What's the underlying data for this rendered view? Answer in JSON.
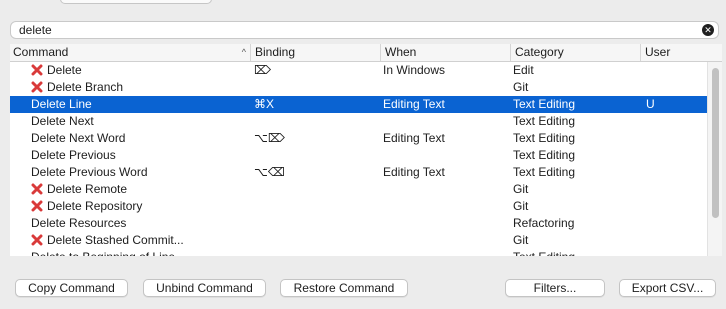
{
  "search": {
    "value": "delete"
  },
  "table": {
    "columns": [
      "Command",
      "Binding",
      "When",
      "Category",
      "User"
    ],
    "rows": [
      {
        "command": "Delete",
        "binding": "⌦",
        "when": "In Windows",
        "category": "Edit",
        "user": "",
        "icon": true,
        "selected": false
      },
      {
        "command": "Delete Branch",
        "binding": "",
        "when": "",
        "category": "Git",
        "user": "",
        "icon": true,
        "selected": false
      },
      {
        "command": "Delete Line",
        "binding": "⌘X",
        "when": "Editing Text",
        "category": "Text Editing",
        "user": "U",
        "icon": false,
        "selected": true
      },
      {
        "command": "Delete Next",
        "binding": "",
        "when": "",
        "category": "Text Editing",
        "user": "",
        "icon": false,
        "selected": false
      },
      {
        "command": "Delete Next Word",
        "binding": "⌥⌦",
        "when": "Editing Text",
        "category": "Text Editing",
        "user": "",
        "icon": false,
        "selected": false
      },
      {
        "command": "Delete Previous",
        "binding": "",
        "when": "",
        "category": "Text Editing",
        "user": "",
        "icon": false,
        "selected": false
      },
      {
        "command": "Delete Previous Word",
        "binding": "⌥⌫",
        "when": "Editing Text",
        "category": "Text Editing",
        "user": "",
        "icon": false,
        "selected": false
      },
      {
        "command": "Delete Remote",
        "binding": "",
        "when": "",
        "category": "Git",
        "user": "",
        "icon": true,
        "selected": false
      },
      {
        "command": "Delete Repository",
        "binding": "",
        "when": "",
        "category": "Git",
        "user": "",
        "icon": true,
        "selected": false
      },
      {
        "command": "Delete Resources",
        "binding": "",
        "when": "",
        "category": "Refactoring",
        "user": "",
        "icon": false,
        "selected": false
      },
      {
        "command": "Delete Stashed Commit...",
        "binding": "",
        "when": "",
        "category": "Git",
        "user": "",
        "icon": true,
        "selected": false
      },
      {
        "command": "Delete to Beginning of Line",
        "binding": "",
        "when": "",
        "category": "Text Editing",
        "user": "",
        "icon": false,
        "selected": false
      }
    ]
  },
  "buttons": {
    "copy": "Copy Command",
    "unbind": "Unbind Command",
    "restore": "Restore Command",
    "filters": "Filters...",
    "export": "Export CSV..."
  },
  "colors": {
    "selection": "#0a63d2",
    "error_icon": "#d93a3a"
  }
}
